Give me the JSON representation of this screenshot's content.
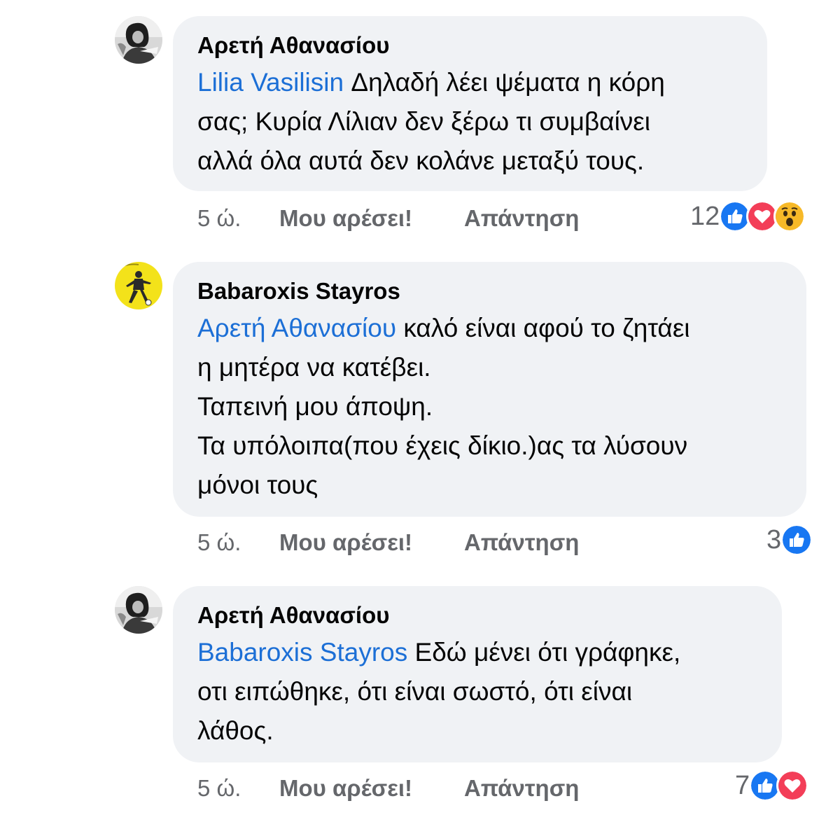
{
  "comments": [
    {
      "author": "Αρετή Αθανασίου",
      "avatar_icon": "profile-photo-icon",
      "mention": "Lilia Vasilisin",
      "line1_rest": " Δηλαδή λέει ψέματα η κόρη",
      "lines": [
        "σας; Κυρία Λίλιαν δεν ξέρω τι συμβαίνει",
        "αλλά όλα αυτά δεν κολάνε μεταξύ τους."
      ],
      "time": "5 ώ.",
      "like_label": "Μου αρέσει!",
      "reply_label": "Απάντηση",
      "reaction_count": "12",
      "reactions": [
        "like-icon",
        "love-icon",
        "wow-icon"
      ]
    },
    {
      "author": "Babaroxis Stayros",
      "avatar_icon": "profile-photo-icon",
      "mention": "Αρετή Αθανασίου",
      "line1_rest": " καλό είναι αφού το ζητάει",
      "lines": [
        "η μητέρα να κατέβει.",
        "Ταπεινή μου άποψη.",
        "Τα υπόλοιπα(που έχεις δίκιο.)ας τα λύσουν",
        "μόνοι τους"
      ],
      "time": "5 ώ.",
      "like_label": "Μου αρέσει!",
      "reply_label": "Απάντηση",
      "reaction_count": "3",
      "reactions": [
        "like-icon"
      ]
    },
    {
      "author": "Αρετή Αθανασίου",
      "avatar_icon": "profile-photo-icon",
      "mention": "Babaroxis Stayros",
      "line1_rest": " Εδώ μένει ότι γράφηκε,",
      "lines": [
        "οτι ειπώθηκε, ότι είναι σωστό, ότι είναι",
        "λάθος."
      ],
      "time": "5 ώ.",
      "like_label": "Μου αρέσει!",
      "reply_label": "Απάντηση",
      "reaction_count": "7",
      "reactions": [
        "like-icon",
        "love-icon"
      ]
    }
  ],
  "colors": {
    "bubble": "#f0f2f5",
    "mention": "#1c6fd6",
    "meta": "#65676b",
    "like_blue": "#1877f2",
    "love_red": "#f33e58",
    "wow_yellow": "#f7b928"
  }
}
